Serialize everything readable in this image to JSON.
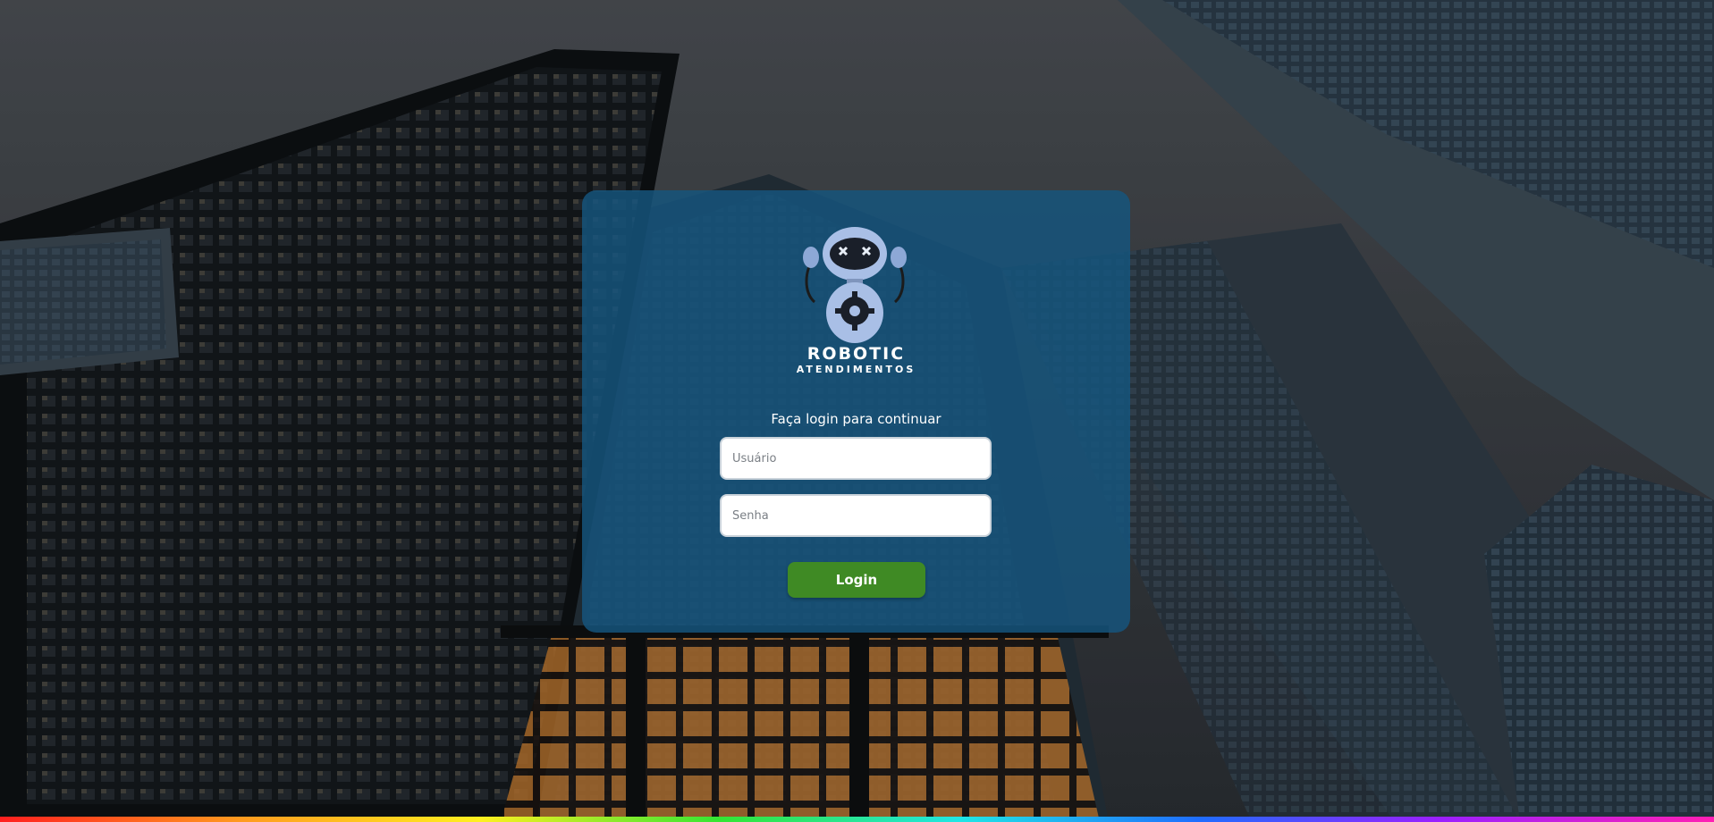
{
  "brand": {
    "name": "ROBOTIC",
    "tagline": "ATENDIMENTOS"
  },
  "login": {
    "prompt": "Faça login para continuar",
    "username_placeholder": "Usuário",
    "username_value": "",
    "password_placeholder": "Senha",
    "password_value": "",
    "button_label": "Login"
  },
  "colors": {
    "card": "#16557d",
    "button": "#3f8a24",
    "text": "#ffffff"
  },
  "icons": {
    "logo": "robot-mascot-icon"
  }
}
